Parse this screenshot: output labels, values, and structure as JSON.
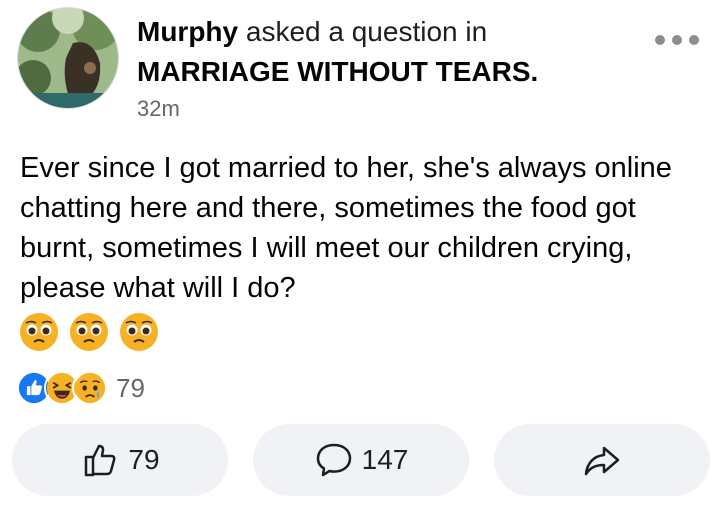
{
  "post": {
    "author": "Murphy",
    "asked_text": "asked a question in",
    "group": "MARRIAGE WITHOUT TEARS.",
    "timestamp": "32m",
    "body": "Ever since I got married to her, she's always online chatting here and there, sometimes the food got burnt, sometimes I will meet our children crying, please what will I do?",
    "body_emoji": [
      "pleading-face-emoji",
      "pleading-face-emoji",
      "pleading-face-emoji"
    ]
  },
  "reactions": {
    "icons": [
      "like-icon",
      "haha-icon",
      "sad-icon"
    ],
    "count": "79"
  },
  "actions": {
    "like_count": "79",
    "comment_count": "147"
  },
  "colors": {
    "like_blue": "#1877f2",
    "emoji_yellow": "#f7b125",
    "secondary_text": "#65676b",
    "button_bg": "#f0f2f5"
  }
}
